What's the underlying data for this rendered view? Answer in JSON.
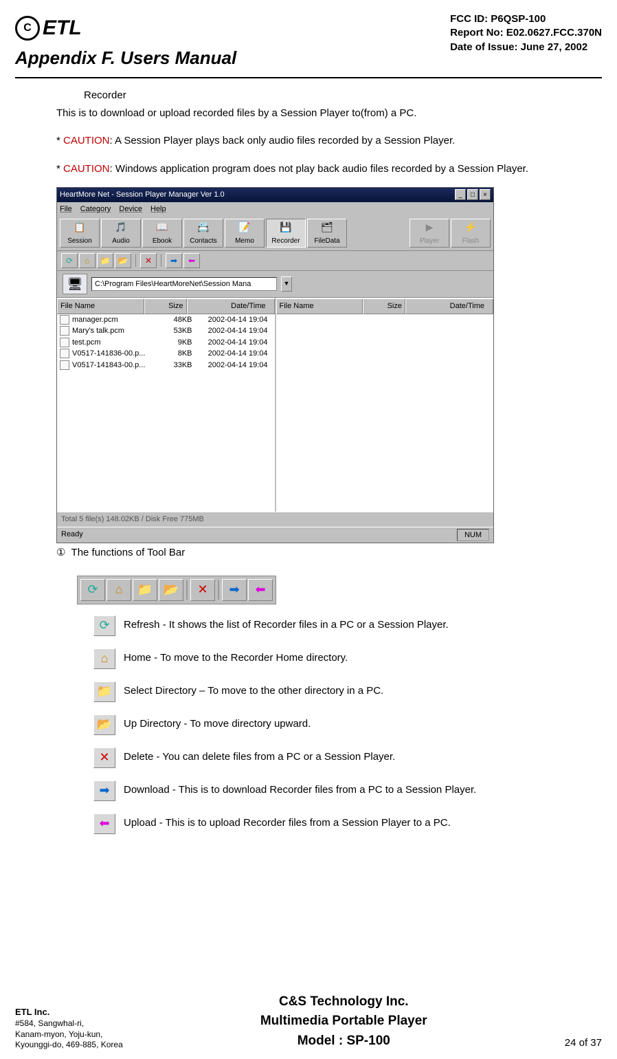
{
  "header": {
    "logo_text": "ETL",
    "appendix": "Appendix F.  Users Manual",
    "meta_fcc": "FCC ID: P6QSP-100",
    "meta_report": "Report No: E02.0627.FCC.370N",
    "meta_date": "Date of Issue: June 27, 2002"
  },
  "body": {
    "subheading": "Recorder",
    "intro": "This is to download or upload recorded files by a Session Player to(from) a PC.",
    "caution_word": "CAUTION",
    "caution1": ": A Session Player plays back only audio files recorded by a Session Player.",
    "caution2": ": Windows application program does not play back audio files recorded by a Session Player.",
    "section_num": "①",
    "section_title": "The functions of Tool Bar"
  },
  "app": {
    "title": "HeartMore Net - Session Player Manager Ver 1.0",
    "menu": [
      "File",
      "Category",
      "Device",
      "Help"
    ],
    "toolbar": [
      {
        "label": "Session",
        "icon": "📋"
      },
      {
        "label": "Audio",
        "icon": "🎵"
      },
      {
        "label": "Ebook",
        "icon": "📖"
      },
      {
        "label": "Contacts",
        "icon": "📇"
      },
      {
        "label": "Memo",
        "icon": "📝"
      },
      {
        "label": "Recorder",
        "icon": "💾",
        "pressed": true
      },
      {
        "label": "FileData",
        "icon": "🗂"
      },
      {
        "label": "Player",
        "icon": "▶",
        "disabled": true
      },
      {
        "label": "Flash",
        "icon": "⚡",
        "disabled": true
      }
    ],
    "path": "C:\\Program Files\\HeartMoreNet\\Session Mana",
    "cols": [
      "File Name",
      "Size",
      "Date/Time"
    ],
    "files": [
      {
        "n": "manager.pcm",
        "s": "48KB",
        "d": "2002-04-14 19:04"
      },
      {
        "n": "Mary's talk.pcm",
        "s": "53KB",
        "d": "2002-04-14 19:04"
      },
      {
        "n": "test.pcm",
        "s": "9KB",
        "d": "2002-04-14 19:04"
      },
      {
        "n": "V0517-141836-00.p...",
        "s": "8KB",
        "d": "2002-04-14 19:04"
      },
      {
        "n": "V0517-141843-00.p...",
        "s": "33KB",
        "d": "2002-04-14 19:04"
      }
    ],
    "status_total": "Total 5 file(s) 148.02KB / Disk Free 775MB",
    "status_ready": "Ready",
    "status_num": "NUM"
  },
  "mini_icons": {
    "refresh": "⟳",
    "home": "⌂",
    "folder": "📁",
    "up": "📂",
    "delete": "✕",
    "right": "➡",
    "left": "⬅"
  },
  "icon_desc": [
    {
      "icon": "⟳",
      "color": "#2a9",
      "text": "Refresh - It shows the list of Recorder files in a PC or a Session Player."
    },
    {
      "icon": "⌂",
      "color": "#c80",
      "text": "Home - To move to the Recorder Home directory."
    },
    {
      "icon": "📁",
      "color": "#cc0",
      "text": "Select Directory – To move to the other directory in a PC."
    },
    {
      "icon": "📂",
      "color": "#cc0",
      "text": "Up Directory - To move directory upward."
    },
    {
      "icon": "✕",
      "color": "#c00",
      "text": "Delete - You can delete files from a PC or a Session Player."
    },
    {
      "icon": "➡",
      "color": "#06c",
      "text": "Download - This is to download Recorder files from a PC to a Session Player."
    },
    {
      "icon": "⬅",
      "color": "#d0d",
      "text": "Upload - This is to upload Recorder files from a Session Player to a PC."
    }
  ],
  "footer": {
    "left_company": "ETL Inc.",
    "left_addr1": "#584, Sangwhal-ri,",
    "left_addr2": "Kanam-myon, Yoju-kun,",
    "left_addr3": "Kyounggi-do, 469-885, Korea",
    "center1": "C&S Technology Inc.",
    "center2": "Multimedia Portable Player",
    "center3": "Model : SP-100",
    "right": "24 of 37"
  }
}
